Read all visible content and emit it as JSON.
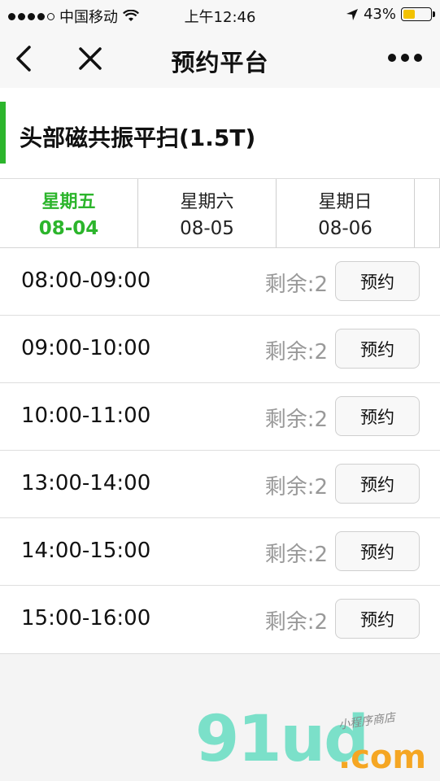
{
  "status_bar": {
    "carrier": "中国移动",
    "time": "上午12:46",
    "battery_percent": "43%",
    "battery_level": 0.43
  },
  "nav": {
    "title": "预约平台"
  },
  "service": {
    "title": "头部磁共振平扫(1.5T)",
    "accent_color": "#2cb52c"
  },
  "date_tabs": [
    {
      "dow": "星期五",
      "date": "08-04",
      "active": true
    },
    {
      "dow": "星期六",
      "date": "08-05",
      "active": false
    },
    {
      "dow": "星期日",
      "date": "08-06",
      "active": false
    }
  ],
  "slots": [
    {
      "time": "08:00-09:00",
      "remain": "剩余:2",
      "button": "预约"
    },
    {
      "time": "09:00-10:00",
      "remain": "剩余:2",
      "button": "预约"
    },
    {
      "time": "10:00-11:00",
      "remain": "剩余:2",
      "button": "预约"
    },
    {
      "time": "13:00-14:00",
      "remain": "剩余:2",
      "button": "预约"
    },
    {
      "time": "14:00-15:00",
      "remain": "剩余:2",
      "button": "预约"
    },
    {
      "time": "15:00-16:00",
      "remain": "剩余:2",
      "button": "预约"
    }
  ],
  "watermark": {
    "main": "91ud",
    "suffix": ".com",
    "small": "小程序商店"
  }
}
